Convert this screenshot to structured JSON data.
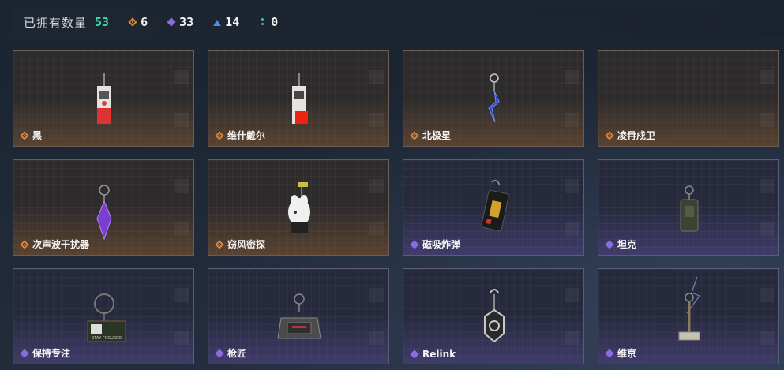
{
  "header": {
    "owned_label": "已拥有数量",
    "owned_total": "53",
    "rarity_counts": [
      {
        "icon": "gold-diamond-icon",
        "count": "6"
      },
      {
        "icon": "purple-diamond-icon",
        "count": "33"
      },
      {
        "icon": "blue-triangle-icon",
        "count": "14"
      },
      {
        "icon": "teal-dots-icon",
        "count": "0"
      }
    ]
  },
  "colors": {
    "gold": "#d9823a",
    "purple": "#8a6be0",
    "blue": "#4a8ee0",
    "teal": "#36c4b6",
    "owned_total": "#38d99a"
  },
  "items": [
    {
      "name": "黑",
      "rarity": "gold",
      "icon": "card-device-charm-icon"
    },
    {
      "name": "维什戴尔",
      "rarity": "gold",
      "icon": "card-device-charm-icon"
    },
    {
      "name": "北极星",
      "rarity": "gold",
      "icon": "blue-star-charm-icon"
    },
    {
      "name": "凌冄戍卫",
      "rarity": "gold",
      "icon": "empty-charm-icon"
    },
    {
      "name": "次声波干扰器",
      "rarity": "gold",
      "icon": "purple-crystal-charm-icon"
    },
    {
      "name": "窃风密探",
      "rarity": "gold",
      "icon": "white-figure-charm-icon"
    },
    {
      "name": "磁吸炸弹",
      "rarity": "purple",
      "icon": "bomb-charm-icon"
    },
    {
      "name": "坦克",
      "rarity": "purple",
      "icon": "tank-charm-icon"
    },
    {
      "name": "保持专注",
      "rarity": "purple",
      "icon": "stay-focused-tag-icon"
    },
    {
      "name": "枪匠",
      "rarity": "purple",
      "icon": "gunsmith-case-charm-icon"
    },
    {
      "name": "Relink",
      "rarity": "purple",
      "icon": "relink-charm-icon"
    },
    {
      "name": "维京",
      "rarity": "purple",
      "icon": "hammer-charm-icon"
    }
  ],
  "tag_text": "STAY FOCUSED"
}
